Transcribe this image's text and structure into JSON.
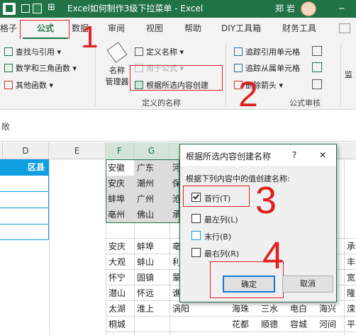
{
  "window": {
    "title": "Excel如何制作3级下拉菜单  -  Excel",
    "user": "郑 岩",
    "minimize_glyph": "─"
  },
  "tabs": [
    "格子",
    "公式",
    "数据",
    "审阅",
    "视图",
    "帮助",
    "DIY工具箱",
    "财务工具"
  ],
  "ribbon": {
    "lookup": "查找与引用",
    "math": "数学和三角函数",
    "other": "其他函数",
    "name_manager_line1": "名称",
    "name_manager_line2": "管理器",
    "define_name": "定义名称",
    "use_in_formula": "用于公式",
    "create_from_selection": "根据所选内容创建",
    "group_defined_names": "定义的名称",
    "trace_precedents": "追踪引用单元格",
    "trace_dependents": "追踪从属单元格",
    "remove_arrows": "删除箭头",
    "group_audit": "公式审核",
    "watch": "监"
  },
  "formula_bar": {
    "fx_partial": "敞"
  },
  "columns": {
    "D": "D",
    "E": "E",
    "F": "F",
    "G": "G"
  },
  "sheet": {
    "d_header": "区县",
    "f_col": [
      "安徽",
      "安庆",
      "蚌埠",
      "亳州"
    ],
    "g_col": [
      "广东",
      "潮州",
      "广州",
      "佛山"
    ],
    "h_col_partial": [
      "河",
      "保",
      "沧",
      "承"
    ],
    "lower_rows": [
      [
        "安庆",
        "蚌埠",
        "亳"
      ],
      [
        "大观",
        "蚌山",
        "利"
      ],
      [
        "怀宁",
        "固镇",
        "蒙"
      ],
      [
        "潜山",
        "怀远",
        "谯"
      ],
      [
        "太湖",
        "淮上",
        "涡阳"
      ],
      [
        "桐城",
        "",
        ""
      ]
    ],
    "right_rows": [
      [
        "海珠",
        "三水",
        "电白",
        "海兴"
      ],
      [
        "花都",
        "顺德",
        "容城",
        "河间"
      ]
    ],
    "far_right": [
      "承",
      "丰",
      "宽",
      "隆",
      "滦",
      "平"
    ]
  },
  "dialog": {
    "title": "根据所选内容创建名称",
    "help": "?",
    "close": "✕",
    "prompt": "根据下列内容中的值创建名称:",
    "options": [
      {
        "label": "首行(T)",
        "checked": true
      },
      {
        "label": "最左列(L)",
        "checked": false
      },
      {
        "label": "末行(B)",
        "checked": false
      },
      {
        "label": "最右列(R)",
        "checked": false
      }
    ],
    "ok": "确定",
    "cancel": "取消"
  },
  "annotations": [
    "1",
    "2",
    "3",
    "4"
  ],
  "colors": {
    "excel_green": "#217346",
    "annotation_red": "#e02020",
    "header_blue": "#0f9ee0"
  }
}
